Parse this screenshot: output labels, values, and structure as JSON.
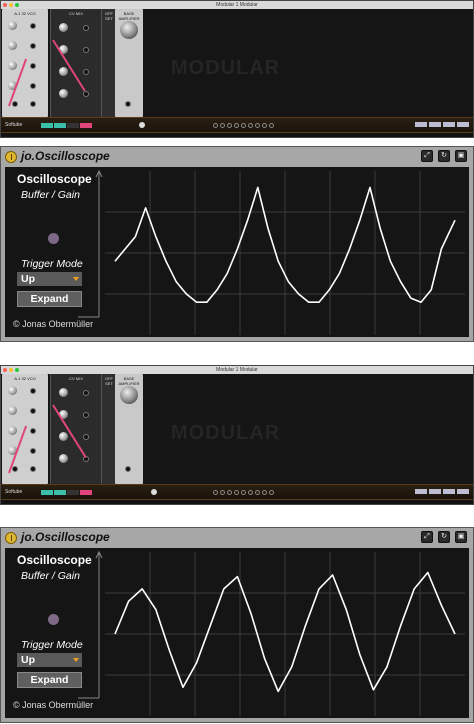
{
  "modular": {
    "window_title": "Modular 1 Modular",
    "vco_label": "A-1 32 VCO",
    "cvmix_label": "CV MIX",
    "offset_label": "OFF SET",
    "amp_label": "BASE AMPLIFIER",
    "brand": "Softube",
    "colors": {
      "cable": "#e0457b",
      "tab_teal": "#3bbfa8",
      "tab_pink": "#e0457b"
    }
  },
  "oscilloscope": {
    "title": "jo.Oscilloscope",
    "panel_title": "Oscilloscope",
    "mode_label": "Buffer / Gain",
    "trigger_label": "Trigger Mode",
    "trigger_value": "Up",
    "expand_label": "Expand",
    "copyright": "© Jonas Obermüller",
    "header_icons": [
      "maximize-icon",
      "refresh-icon",
      "save-icon"
    ]
  },
  "chart_data": [
    {
      "type": "line",
      "title": "",
      "xlabel": "",
      "ylabel": "",
      "grid": true,
      "xlim": [
        0,
        100
      ],
      "ylim": [
        -1,
        1
      ],
      "series": [
        {
          "x": [
            0,
            3,
            6,
            9,
            12,
            15,
            18,
            21,
            24,
            27,
            30,
            33,
            36,
            39,
            42,
            45,
            48,
            51,
            54,
            57,
            60,
            63,
            66,
            69,
            72,
            75,
            78,
            81,
            84,
            87,
            90,
            93,
            96,
            100
          ],
          "values": [
            -0.1,
            0.05,
            0.2,
            0.55,
            0.2,
            -0.1,
            -0.35,
            -0.5,
            -0.6,
            -0.6,
            -0.45,
            -0.25,
            0.05,
            0.4,
            0.8,
            0.3,
            -0.1,
            -0.35,
            -0.5,
            -0.6,
            -0.6,
            -0.45,
            -0.25,
            0.05,
            0.4,
            0.8,
            0.3,
            -0.1,
            -0.35,
            -0.55,
            -0.6,
            -0.45,
            0.05,
            0.4
          ]
        }
      ]
    },
    {
      "type": "line",
      "title": "",
      "xlabel": "",
      "ylabel": "",
      "grid": true,
      "xlim": [
        0,
        100
      ],
      "ylim": [
        -1,
        1
      ],
      "series": [
        {
          "x": [
            0,
            4,
            8,
            12,
            16,
            20,
            24,
            28,
            32,
            36,
            40,
            44,
            48,
            52,
            56,
            60,
            64,
            68,
            72,
            76,
            80,
            84,
            88,
            92,
            96,
            100
          ],
          "values": [
            0.0,
            0.4,
            0.55,
            0.3,
            -0.2,
            -0.65,
            -0.35,
            0.1,
            0.55,
            0.7,
            0.25,
            -0.3,
            -0.7,
            -0.4,
            0.1,
            0.55,
            0.72,
            0.3,
            -0.25,
            -0.68,
            -0.4,
            0.1,
            0.55,
            0.75,
            0.35,
            0.0
          ]
        }
      ]
    }
  ]
}
